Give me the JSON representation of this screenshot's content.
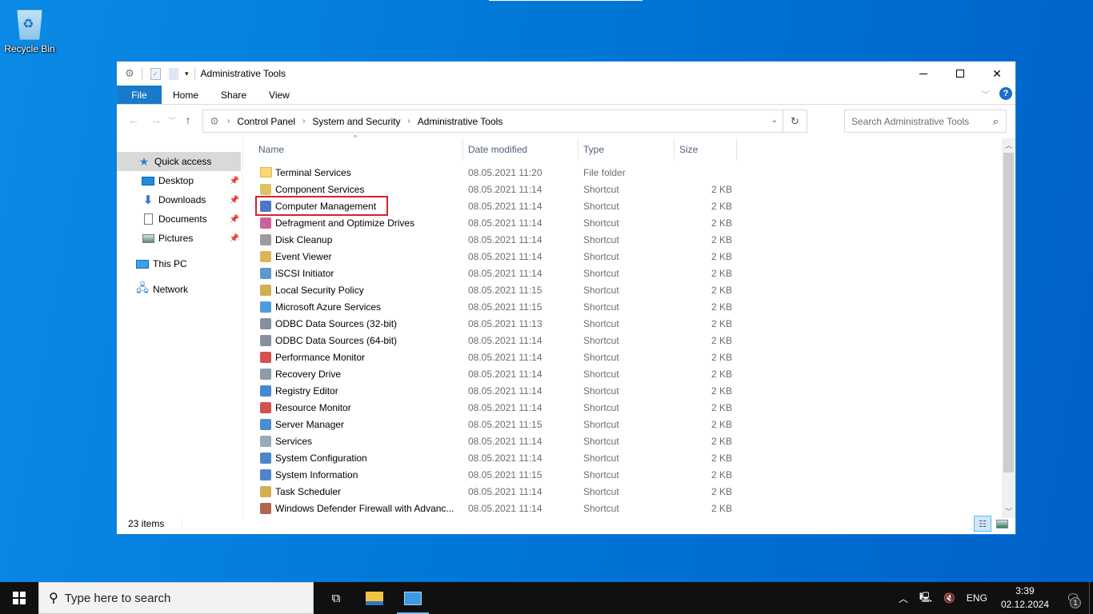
{
  "desktop": {
    "icons": [
      {
        "label": "Recycle Bin",
        "icon": "recycle-bin-icon"
      }
    ]
  },
  "window": {
    "title": "Administrative Tools",
    "controls": {
      "minimize": "minimize",
      "maximize": "maximize",
      "close": "close"
    },
    "ribbon_tabs": [
      "File",
      "Home",
      "Share",
      "View"
    ],
    "address": {
      "breadcrumbs": [
        "Control Panel",
        "System and Security",
        "Administrative Tools"
      ]
    },
    "search": {
      "placeholder": "Search Administrative Tools",
      "value": ""
    },
    "sidebar": {
      "items": [
        {
          "label": "Quick access",
          "icon": "star-icon",
          "active": true,
          "pinned": false
        },
        {
          "label": "Desktop",
          "icon": "desktop-icon",
          "pinned": true
        },
        {
          "label": "Downloads",
          "icon": "download-arrow-icon",
          "pinned": true
        },
        {
          "label": "Documents",
          "icon": "document-icon",
          "pinned": true
        },
        {
          "label": "Pictures",
          "icon": "pictures-icon",
          "pinned": true
        },
        {
          "label": "This PC",
          "icon": "computer-icon",
          "pinned": false
        },
        {
          "label": "Network",
          "icon": "network-icon",
          "pinned": false
        }
      ]
    },
    "columns": [
      "Name",
      "Date modified",
      "Type",
      "Size"
    ],
    "sort_column": "Name",
    "files": [
      {
        "name": "Terminal Services",
        "date": "08.05.2021 11:20",
        "type": "File folder",
        "size": "",
        "icon": "folder-icon"
      },
      {
        "name": "Component Services",
        "date": "08.05.2021 11:14",
        "type": "Shortcut",
        "size": "2 KB",
        "icon": "component-services-icon"
      },
      {
        "name": "Computer Management",
        "date": "08.05.2021 11:14",
        "type": "Shortcut",
        "size": "2 KB",
        "icon": "computer-management-icon",
        "highlighted": true
      },
      {
        "name": "Defragment and Optimize Drives",
        "date": "08.05.2021 11:14",
        "type": "Shortcut",
        "size": "2 KB",
        "icon": "defrag-icon"
      },
      {
        "name": "Disk Cleanup",
        "date": "08.05.2021 11:14",
        "type": "Shortcut",
        "size": "2 KB",
        "icon": "disk-cleanup-icon"
      },
      {
        "name": "Event Viewer",
        "date": "08.05.2021 11:14",
        "type": "Shortcut",
        "size": "2 KB",
        "icon": "event-viewer-icon"
      },
      {
        "name": "iSCSI Initiator",
        "date": "08.05.2021 11:14",
        "type": "Shortcut",
        "size": "2 KB",
        "icon": "iscsi-icon"
      },
      {
        "name": "Local Security Policy",
        "date": "08.05.2021 11:15",
        "type": "Shortcut",
        "size": "2 KB",
        "icon": "security-policy-icon"
      },
      {
        "name": "Microsoft Azure Services",
        "date": "08.05.2021 11:15",
        "type": "Shortcut",
        "size": "2 KB",
        "icon": "azure-icon"
      },
      {
        "name": "ODBC Data Sources (32-bit)",
        "date": "08.05.2021 11:13",
        "type": "Shortcut",
        "size": "2 KB",
        "icon": "odbc-icon"
      },
      {
        "name": "ODBC Data Sources (64-bit)",
        "date": "08.05.2021 11:14",
        "type": "Shortcut",
        "size": "2 KB",
        "icon": "odbc-icon"
      },
      {
        "name": "Performance Monitor",
        "date": "08.05.2021 11:14",
        "type": "Shortcut",
        "size": "2 KB",
        "icon": "performance-monitor-icon"
      },
      {
        "name": "Recovery Drive",
        "date": "08.05.2021 11:14",
        "type": "Shortcut",
        "size": "2 KB",
        "icon": "recovery-drive-icon"
      },
      {
        "name": "Registry Editor",
        "date": "08.05.2021 11:14",
        "type": "Shortcut",
        "size": "2 KB",
        "icon": "registry-editor-icon"
      },
      {
        "name": "Resource Monitor",
        "date": "08.05.2021 11:14",
        "type": "Shortcut",
        "size": "2 KB",
        "icon": "resource-monitor-icon"
      },
      {
        "name": "Server Manager",
        "date": "08.05.2021 11:15",
        "type": "Shortcut",
        "size": "2 KB",
        "icon": "server-manager-icon"
      },
      {
        "name": "Services",
        "date": "08.05.2021 11:14",
        "type": "Shortcut",
        "size": "2 KB",
        "icon": "services-icon"
      },
      {
        "name": "System Configuration",
        "date": "08.05.2021 11:14",
        "type": "Shortcut",
        "size": "2 KB",
        "icon": "system-configuration-icon"
      },
      {
        "name": "System Information",
        "date": "08.05.2021 11:15",
        "type": "Shortcut",
        "size": "2 KB",
        "icon": "system-information-icon"
      },
      {
        "name": "Task Scheduler",
        "date": "08.05.2021 11:14",
        "type": "Shortcut",
        "size": "2 KB",
        "icon": "task-scheduler-icon"
      },
      {
        "name": "Windows Defender Firewall with Advanc...",
        "date": "08.05.2021 11:14",
        "type": "Shortcut",
        "size": "2 KB",
        "icon": "firewall-icon"
      }
    ],
    "status": {
      "item_count": "23 items"
    },
    "view_modes": [
      "details",
      "large-icons"
    ],
    "active_view": "details"
  },
  "taskbar": {
    "search_placeholder": "Type here to search",
    "apps": [
      {
        "name": "task-view",
        "active": false
      },
      {
        "name": "file-explorer",
        "active": false
      },
      {
        "name": "control-panel",
        "active": true
      }
    ],
    "tray": {
      "language": "ENG",
      "time": "3:39",
      "date": "02.12.2024",
      "notification_count": "1"
    }
  }
}
